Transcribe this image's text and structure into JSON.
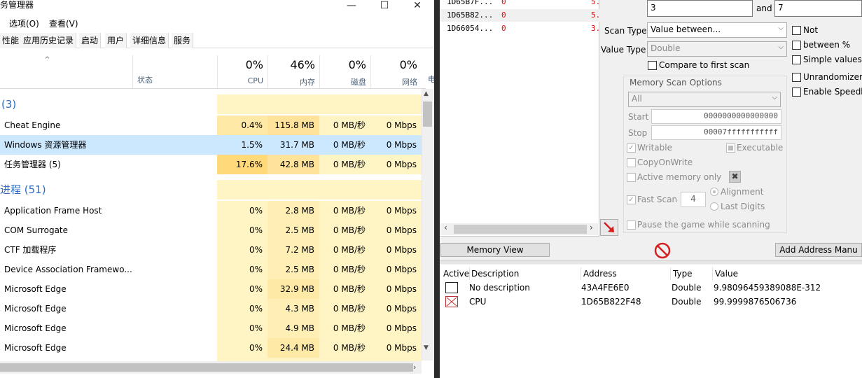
{
  "taskmgr": {
    "title": "务管理器",
    "menu": [
      "选项(O)",
      "查看(V)"
    ],
    "tabs": [
      "性能",
      "应用历史记录",
      "启动",
      "用户",
      "详细信息",
      "服务"
    ],
    "columns": {
      "status": "状态",
      "cpu": {
        "pct": "0%",
        "label": "CPU"
      },
      "mem": {
        "pct": "46%",
        "label": "内存"
      },
      "disk": {
        "pct": "0%",
        "label": "磁盘"
      },
      "net": {
        "pct": "0%",
        "label": "网络"
      },
      "extra": "电"
    },
    "groups": {
      "apps": "(3)",
      "bg": "进程 (51)"
    },
    "apps": [
      {
        "name": "Cheat Engine",
        "cpu": "0.4%",
        "mem": "115.8 MB",
        "disk": "0 MB/秒",
        "net": "0 Mbps"
      },
      {
        "name": "Windows 资源管理器",
        "cpu": "1.5%",
        "mem": "31.7 MB",
        "disk": "0 MB/秒",
        "net": "0 Mbps"
      },
      {
        "name": "任务管理器 (5)",
        "cpu": "17.6%",
        "mem": "42.8 MB",
        "disk": "0 MB/秒",
        "net": "0 Mbps"
      }
    ],
    "processes": [
      {
        "name": "Application Frame Host",
        "cpu": "0%",
        "mem": "2.8 MB",
        "disk": "0 MB/秒",
        "net": "0 Mbps"
      },
      {
        "name": "COM Surrogate",
        "cpu": "0%",
        "mem": "2.5 MB",
        "disk": "0 MB/秒",
        "net": "0 Mbps"
      },
      {
        "name": "CTF 加载程序",
        "cpu": "0%",
        "mem": "7.2 MB",
        "disk": "0 MB/秒",
        "net": "0 Mbps"
      },
      {
        "name": "Device Association Framewo...",
        "cpu": "0%",
        "mem": "2.5 MB",
        "disk": "0 MB/秒",
        "net": "0 Mbps"
      },
      {
        "name": "Microsoft Edge",
        "cpu": "0%",
        "mem": "32.9 MB",
        "disk": "0 MB/秒",
        "net": "0 Mbps"
      },
      {
        "name": "Microsoft Edge",
        "cpu": "0%",
        "mem": "4.3 MB",
        "disk": "0 MB/秒",
        "net": "0 Mbps"
      },
      {
        "name": "Microsoft Edge",
        "cpu": "0%",
        "mem": "4.9 MB",
        "disk": "0 MB/秒",
        "net": "0 Mbps"
      },
      {
        "name": "Microsoft Edge",
        "cpu": "0%",
        "mem": "24.4 MB",
        "disk": "0 MB/秒",
        "net": "0 Mbps"
      }
    ]
  },
  "cheatengine": {
    "found": [
      {
        "addr": "1D65B7F...",
        "v0": "0",
        "v1": "5."
      },
      {
        "addr": "1D65B82...",
        "v0": "0",
        "v1": "5."
      },
      {
        "addr": "1D66054...",
        "v0": "0",
        "v1": "3."
      }
    ],
    "value1": "3",
    "and_label": "and",
    "value2": "7",
    "scan_type_label": "Scan Type",
    "scan_type_value": "Value between...",
    "value_type_label": "Value Type",
    "value_type_value": "Double",
    "compare_first": "Compare to first scan",
    "not_label": "Not",
    "between_pct": "between %",
    "simple_values": "Simple values o",
    "unrandomizer": "Unrandomizer",
    "enable_speedhack": "Enable Speedh",
    "mem_opts": {
      "title": "Memory Scan Options",
      "region": "All",
      "start_label": "Start",
      "start_value": "0000000000000000",
      "stop_label": "Stop",
      "stop_value": "00007fffffffffff",
      "writable": "Writable",
      "executable": "Executable",
      "copyonwrite": "CopyOnWrite",
      "active_memory": "Active memory only",
      "fast_scan": "Fast Scan",
      "fast_scan_value": "4",
      "alignment": "Alignment",
      "last_digits": "Last Digits",
      "pause_game": "Pause the game while scanning"
    },
    "memory_view_btn": "Memory View",
    "add_address_btn": "Add Address Manu",
    "table": {
      "headers": {
        "active": "Active",
        "description": "Description",
        "address": "Address",
        "type": "Type",
        "value": "Value"
      },
      "rows": [
        {
          "description": "No description",
          "address": "43A4FE6E0",
          "type": "Double",
          "value": "9.98096459389088E-312"
        },
        {
          "description": "CPU",
          "address": "1D65B822F48",
          "type": "Double",
          "value": "99.9999876506736"
        }
      ]
    }
  }
}
